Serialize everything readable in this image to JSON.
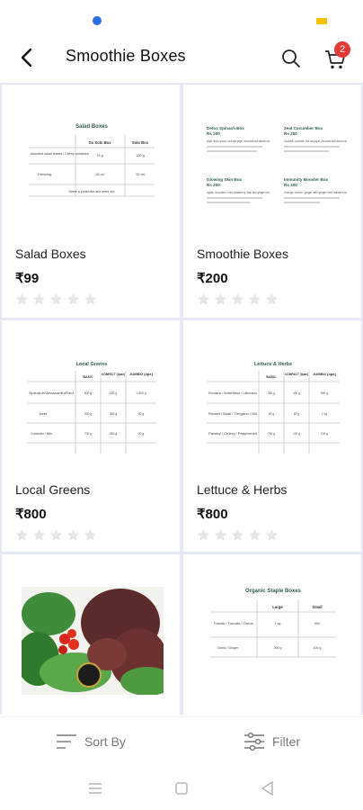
{
  "header": {
    "title": "Smoothie Boxes",
    "cart_count": "2"
  },
  "products": [
    {
      "name": "Salad Boxes",
      "price": "₹99",
      "rating": 0,
      "thumb": {
        "heading": "Salad Boxes",
        "cols": [
          "Go Solo Box",
          "Solo Box"
        ],
        "rows": [
          [
            "Assorted salad leaves / Cherry tomatoes",
            "75 g",
            "100 g"
          ],
          [
            "Dressing",
            "25 ml",
            "50 ml"
          ]
        ],
        "footer": "Same a protective and seed mix"
      }
    },
    {
      "name": "Smoothie Boxes",
      "price": "₹200",
      "rating": 0,
      "thumb": {
        "boxes": [
          {
            "title": "Detox Spinach Box",
            "price": "Rs 200",
            "desc": "Apple, lemon spinach, mint with ginger, chia seeds and cashew mix"
          },
          {
            "title": "Zeal Cucumber Box",
            "price": "Rs 200",
            "desc": "Cucumber, cucumber, mint and yogurt, chia seeds and cashew mix"
          },
          {
            "title": "Glowing Skin Box",
            "price": "Rs 200",
            "desc": "Apple, cucumber, mint strawberry, kale and ginger mix"
          },
          {
            "title": "Immunity Booster Box",
            "price": "Rs 200",
            "desc": "Orange, lemon, ginger with ginger mint leaves mix"
          }
        ]
      }
    },
    {
      "name": "Local Greens",
      "price": "₹800",
      "rating": 0,
      "thumb": {
        "heading": "Local Greens",
        "cols": [
          "BASIC",
          "COMPACT (2pax)",
          "JUMBO (4px)"
        ],
        "rows": [
          [
            "Spinach/Amaranth/Red",
            "500 g",
            "400 g",
            "1,500 g"
          ],
          [
            "Methi",
            "200 g",
            "300 g",
            "00 g"
          ],
          [
            "Coriander / Mint",
            "700 g",
            "250 g",
            "00 g"
          ]
        ]
      }
    },
    {
      "name": "Lettuce & Herbs",
      "price": "₹800",
      "rating": 0,
      "thumb": {
        "heading": "Lettuce & Herbs",
        "cols": [
          "BASIC",
          "COMPACT (2pax)",
          "JUMBO (4px)"
        ],
        "rows": [
          [
            "Romaine / Butterhead / Lollorosso",
            "300 g",
            "400 g",
            "500 g"
          ],
          [
            "Rocket / Basil / Oregano / Dill",
            "50 g",
            "80 g",
            "1 kg"
          ],
          [
            "Parsley / Celery / Peppermint",
            "700 g",
            "100 g",
            "100 g"
          ]
        ]
      }
    },
    {
      "name": "",
      "price": "",
      "rating": 0,
      "thumb": {
        "photo": true
      }
    },
    {
      "name": "",
      "price": "",
      "rating": 0,
      "thumb": {
        "heading": "Organic Staple Boxes",
        "cols": [
          "Large",
          "Small"
        ],
        "rows": [
          [
            "Potato / Tomato / Onion",
            "1 kg",
            "500"
          ],
          [
            "Garlic / Ginger",
            "200 g",
            "100 g"
          ]
        ]
      }
    }
  ],
  "bottom_bar": {
    "sort_label": "Sort By",
    "filter_label": "Filter"
  },
  "colors": {
    "accent_badge": "#e53935",
    "grid_divider": "#e6e8f5",
    "star_empty": "#e6e6e6"
  },
  "icons": [
    "back-arrow-icon",
    "search-icon",
    "cart-icon",
    "sort-icon",
    "filter-icon",
    "menu-icon",
    "home-square-icon",
    "back-triangle-icon"
  ]
}
